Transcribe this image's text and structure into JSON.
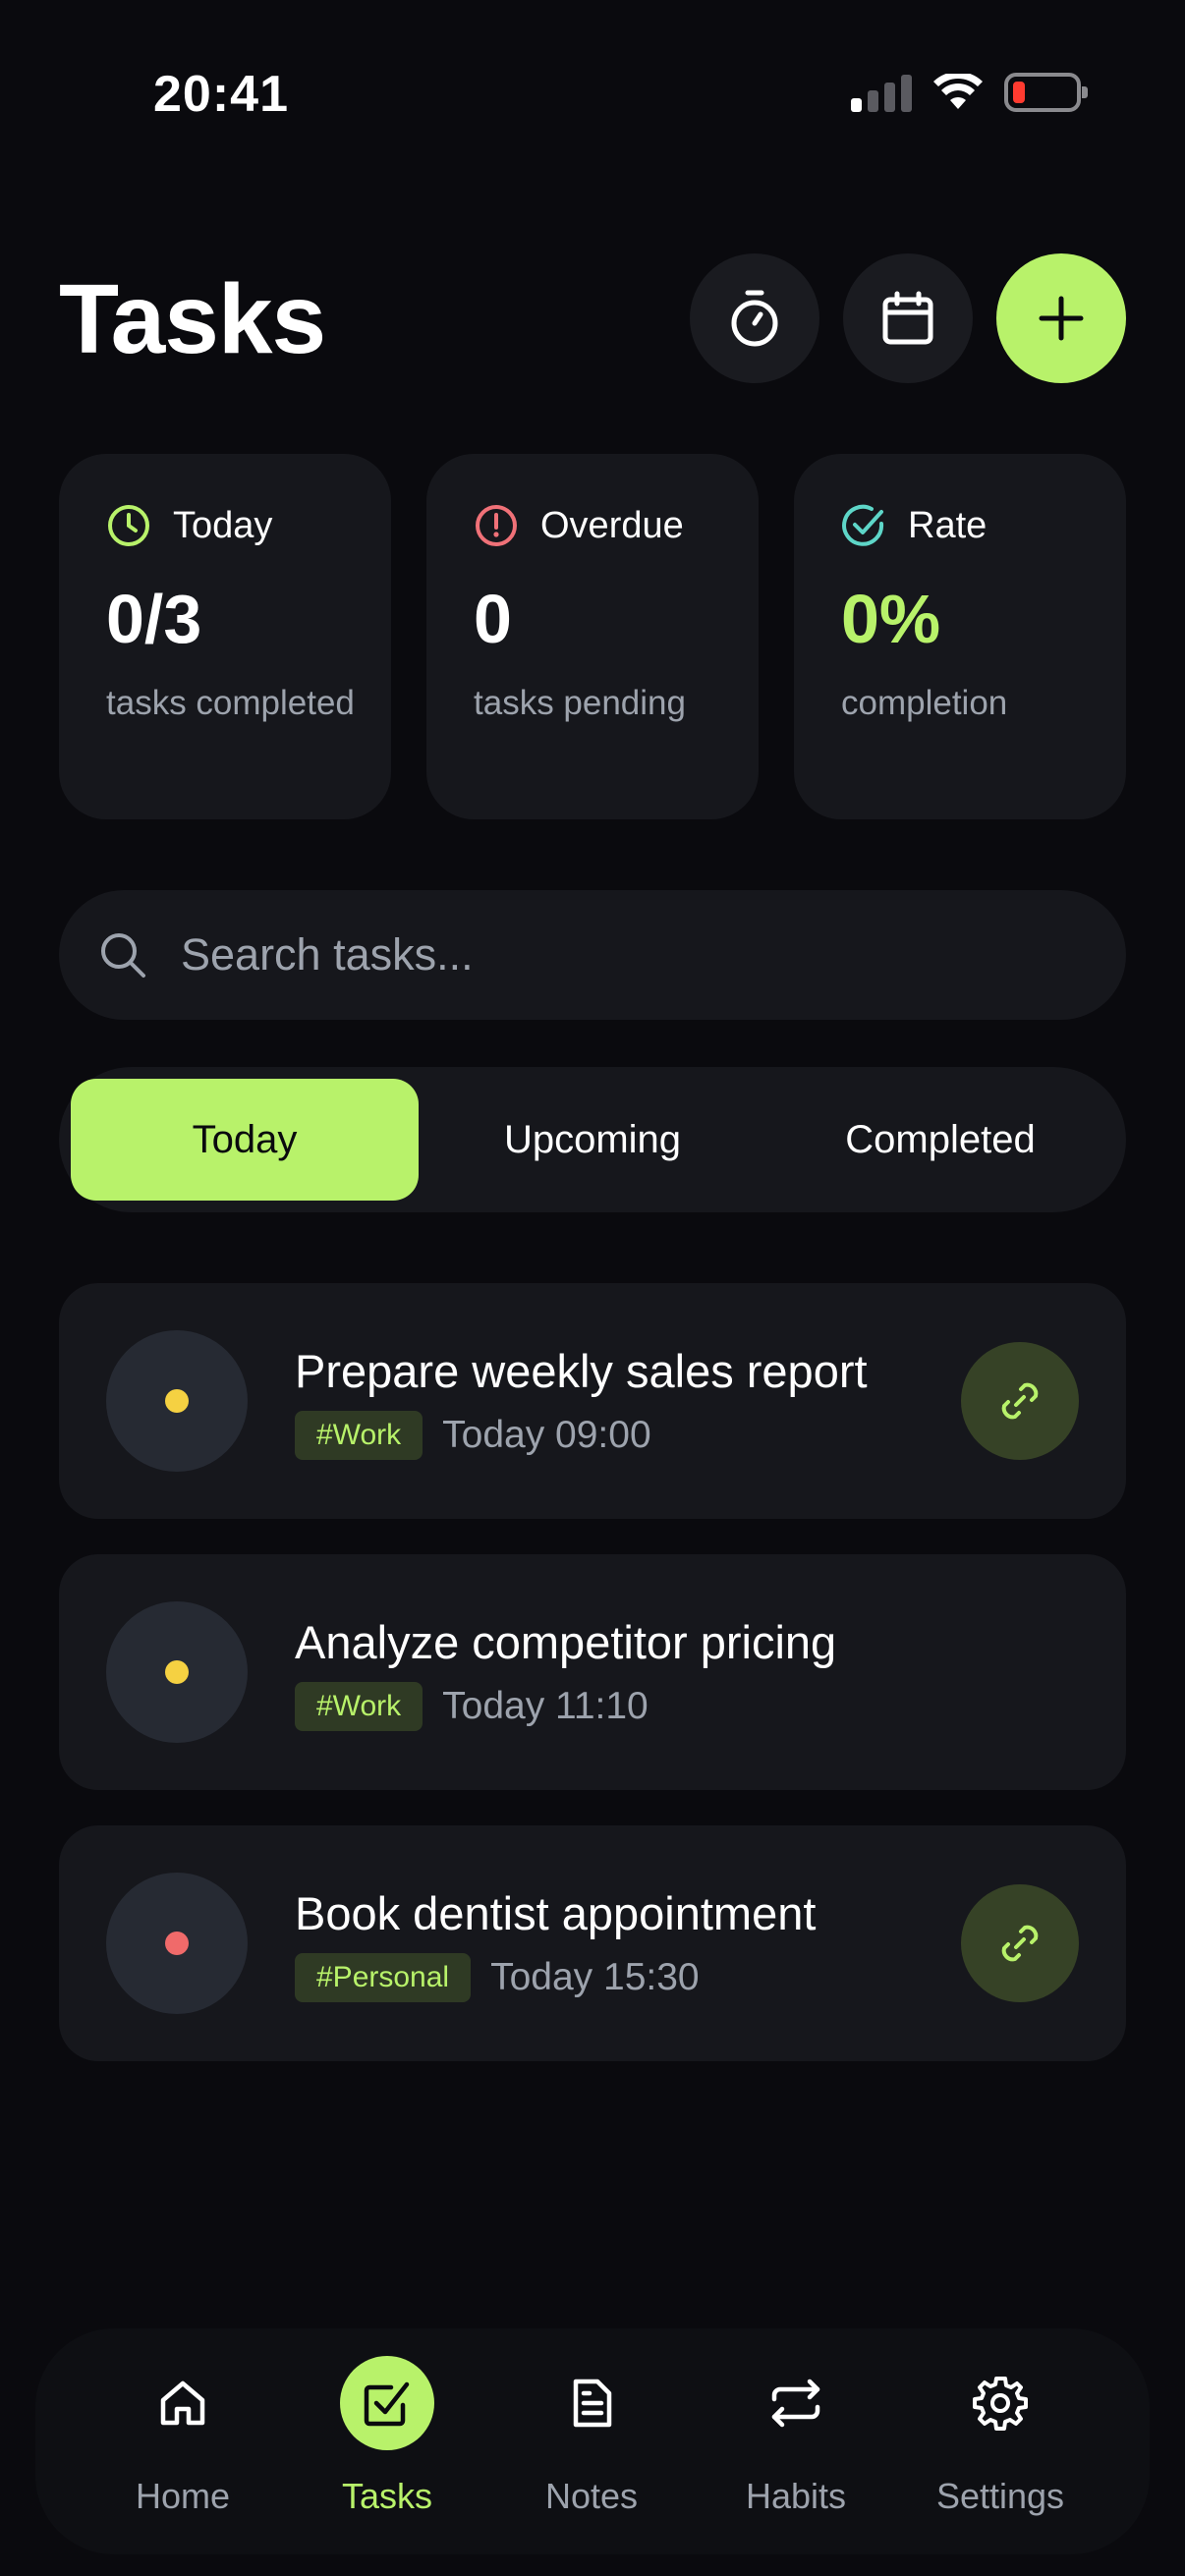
{
  "status_bar": {
    "time": "20:41"
  },
  "header": {
    "title": "Tasks"
  },
  "stats": [
    {
      "label": "Today",
      "value": "0/3",
      "sub": "tasks completed",
      "icon": "clock-icon",
      "icon_color": "#b8f26a"
    },
    {
      "label": "Overdue",
      "value": "0",
      "sub": "tasks pending",
      "icon": "alert-circle-icon",
      "icon_color": "#f07178"
    },
    {
      "label": "Rate",
      "value": "0%",
      "sub": "completion",
      "icon": "check-circle-icon",
      "icon_color": "#5ed6c8"
    }
  ],
  "search": {
    "placeholder": "Search tasks..."
  },
  "tabs": [
    {
      "label": "Today",
      "active": true
    },
    {
      "label": "Upcoming",
      "active": false
    },
    {
      "label": "Completed",
      "active": false
    }
  ],
  "tasks": [
    {
      "title": "Prepare weekly sales report",
      "tag": "#Work",
      "time": "Today 09:00",
      "priority_color": "#f5d142",
      "has_link": true
    },
    {
      "title": "Analyze competitor pricing",
      "tag": "#Work",
      "time": "Today 11:10",
      "priority_color": "#f5d142",
      "has_link": false
    },
    {
      "title": "Book dentist appointment",
      "tag": "#Personal",
      "time": "Today 15:30",
      "priority_color": "#f06a6a",
      "has_link": true
    }
  ],
  "nav": [
    {
      "label": "Home",
      "icon": "home-icon",
      "active": false
    },
    {
      "label": "Tasks",
      "icon": "checkbox-icon",
      "active": true
    },
    {
      "label": "Notes",
      "icon": "document-icon",
      "active": false
    },
    {
      "label": "Habits",
      "icon": "repeat-icon",
      "active": false
    },
    {
      "label": "Settings",
      "icon": "gear-icon",
      "active": false
    }
  ],
  "colors": {
    "accent": "#b8f26a",
    "background": "#0a0a0e",
    "card": "#16171c"
  }
}
